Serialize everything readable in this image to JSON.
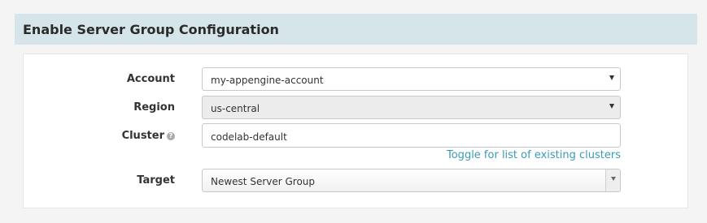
{
  "header": {
    "title": "Enable Server Group Configuration"
  },
  "form": {
    "account": {
      "label": "Account",
      "value": "my-appengine-account"
    },
    "region": {
      "label": "Region",
      "value": "us-central"
    },
    "cluster": {
      "label": "Cluster",
      "value": "codelab-default",
      "help_icon": "question-circle-icon"
    },
    "toggle_link": "Toggle for list of existing clusters",
    "target": {
      "label": "Target",
      "value": "Newest Server Group"
    }
  },
  "colors": {
    "header_bg": "#d5e5ea",
    "link": "#3a9bb5",
    "disabled_bg": "#ececec"
  }
}
